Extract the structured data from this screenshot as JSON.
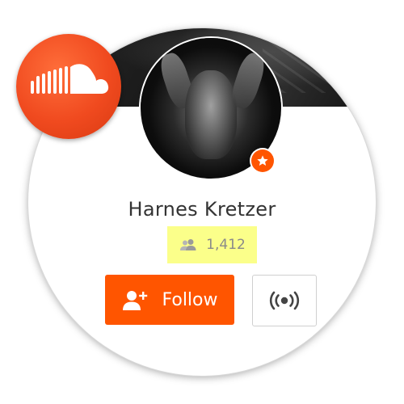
{
  "app": {
    "logo_icon": "soundcloud-logo-icon",
    "accent_color": "#ff5500",
    "logo_color": "#f04a1f"
  },
  "profile": {
    "name": "Harnes Kretzer",
    "pro_badge_icon": "star-icon",
    "followers_icon": "users-icon",
    "followers_count": "1,412",
    "followers_highlight_color": "#fbff8a"
  },
  "actions": {
    "follow_label": "Follow",
    "follow_icon": "add-user-icon",
    "station_icon": "broadcast-icon"
  }
}
